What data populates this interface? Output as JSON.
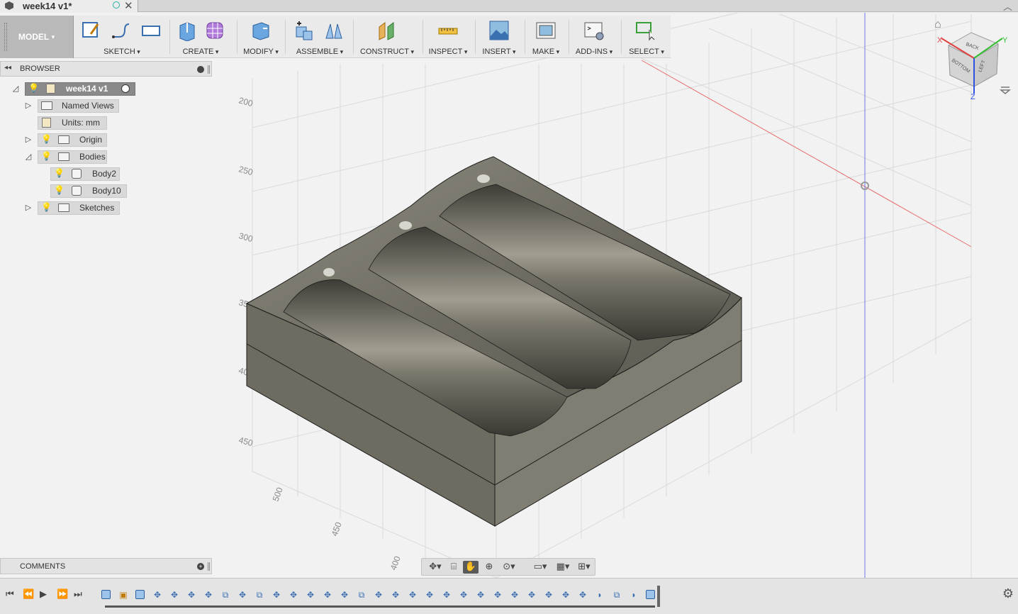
{
  "document": {
    "title": "week14 v1*"
  },
  "toolbar": {
    "workspace": "MODEL",
    "groups": [
      {
        "label": "SKETCH"
      },
      {
        "label": "CREATE"
      },
      {
        "label": "MODIFY"
      },
      {
        "label": "ASSEMBLE"
      },
      {
        "label": "CONSTRUCT"
      },
      {
        "label": "INSPECT"
      },
      {
        "label": "INSERT"
      },
      {
        "label": "MAKE"
      },
      {
        "label": "ADD-INS"
      },
      {
        "label": "SELECT"
      }
    ]
  },
  "browser": {
    "title": "BROWSER",
    "root": "week14 v1",
    "nodes": [
      {
        "label": "Named Views"
      },
      {
        "label": "Units: mm"
      },
      {
        "label": "Origin"
      },
      {
        "label": "Bodies"
      },
      {
        "label": "Body2"
      },
      {
        "label": "Body10"
      },
      {
        "label": "Sketches"
      }
    ]
  },
  "comments": {
    "title": "COMMENTS"
  },
  "viewport": {
    "grid_labels_left": [
      "200",
      "250",
      "300",
      "35",
      "40",
      "450"
    ],
    "grid_labels_bottom": [
      "500",
      "450",
      "400"
    ]
  },
  "viewcube": {
    "faces": [
      "BACK",
      "BOTTOM",
      "LEFT"
    ],
    "axes": [
      "X",
      "Y",
      "Z"
    ]
  },
  "colors": {
    "accent": "#27b0a0",
    "toolbar_bg": "#eaeaea",
    "model_button_bg": "#b9b9b9",
    "body": "#6b685c",
    "x_axis": "#e04040",
    "y_axis": "#2fbf2f",
    "z_axis": "#3050e0"
  }
}
